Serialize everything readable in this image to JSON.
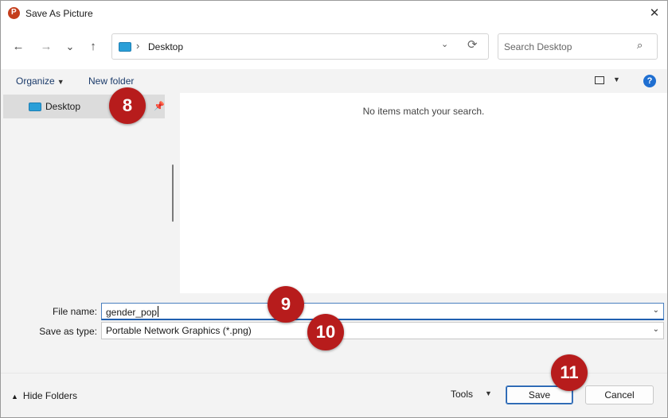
{
  "window": {
    "title": "Save As Picture",
    "close": "✕"
  },
  "nav": {
    "back": "←",
    "forward": "→",
    "recent": "⌄",
    "up": "↑",
    "address": {
      "separator": "›",
      "location": "Desktop",
      "dropdown": "⌄",
      "refresh": "⟳"
    },
    "search": {
      "placeholder": "Search Desktop",
      "icon": "⌕"
    }
  },
  "toolbar": {
    "organize": "Organize",
    "organize_caret": "▼",
    "new_folder": "New folder",
    "view_caret": "▼",
    "help": "?"
  },
  "sidebar": {
    "items": [
      {
        "label": "Desktop",
        "pin": "📌"
      }
    ]
  },
  "content": {
    "empty_message": "No items match your search."
  },
  "form": {
    "filename_label": "File name:",
    "filename_value": "gender_pop",
    "savetype_label": "Save as type:",
    "savetype_value": "Portable Network Graphics (*.png)",
    "dropdown": "⌄"
  },
  "footer": {
    "hide_folders": "Hide Folders",
    "hide_caret": "▲",
    "tools": "Tools",
    "tools_caret": "▼",
    "save": "Save",
    "cancel": "Cancel"
  },
  "markers": [
    "8",
    "9",
    "10",
    "11"
  ],
  "colors": {
    "marker": "#b71c1c",
    "accent": "#1f5fb0",
    "help": "#1f6fd1",
    "app_icon": "#c43e1c"
  }
}
